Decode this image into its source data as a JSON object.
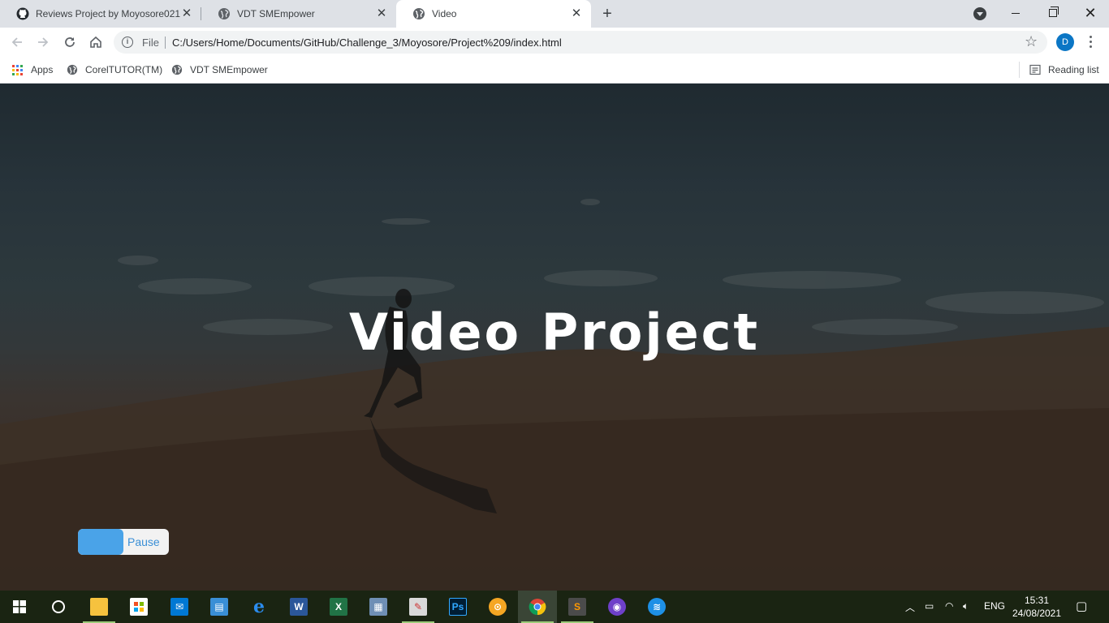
{
  "browser": {
    "tabs": [
      {
        "title": "Reviews Project by Moyosore021",
        "icon": "github-icon"
      },
      {
        "title": "VDT SMEmpower",
        "icon": "globe-icon"
      },
      {
        "title": "Video",
        "icon": "globe-icon",
        "active": true
      }
    ],
    "address": {
      "scheme_label": "File",
      "url": "C:/Users/Home/Documents/GitHub/Challenge_3/Moyosore/Project%209/index.html"
    },
    "profile_initial": "D",
    "bookmarks": [
      {
        "label": "Apps",
        "icon": "apps-grid-icon"
      },
      {
        "label": "CorelTUTOR(TM)",
        "icon": "globe-icon"
      },
      {
        "label": "VDT SMEmpower",
        "icon": "globe-icon"
      }
    ],
    "reading_list_label": "Reading list"
  },
  "page": {
    "title": "Video Project",
    "video_toggle": {
      "label": "Pause",
      "accent": "#4aa3e8"
    }
  },
  "taskbar": {
    "apps": [
      "file-explorer-icon",
      "store-icon",
      "mail-icon",
      "contacts-icon",
      "edge-icon",
      "word-icon",
      "excel-icon",
      "scanner-icon",
      "paint-icon",
      "photoshop-icon",
      "vpn-icon",
      "chrome-icon",
      "sublime-icon",
      "github-desktop-icon",
      "network-app-icon"
    ],
    "language": "ENG",
    "time": "15:31",
    "date": "24/08/2021"
  }
}
